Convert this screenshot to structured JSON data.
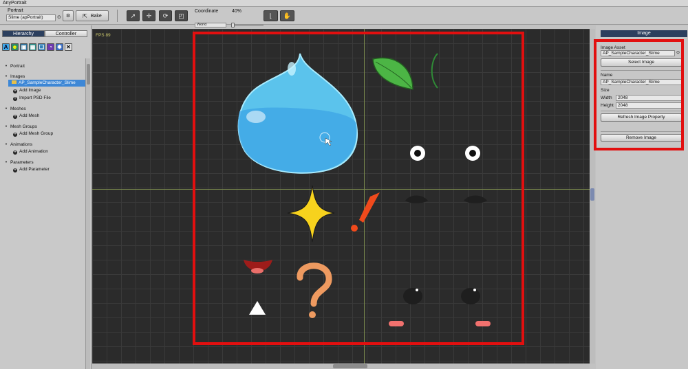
{
  "app": {
    "title": "AnyPortrait"
  },
  "toolbar": {
    "portrait_label": "Portrait",
    "portrait_value": "Slime (apPortrait)",
    "bake_label": "Bake",
    "coordinate_label": "Coordinate",
    "coordinate_value": "World",
    "zoom_label": "40%",
    "zoom_level": 0.0
  },
  "left": {
    "tabs": [
      {
        "label": "Hierarchy"
      },
      {
        "label": "Controller"
      }
    ],
    "tool_icons": [
      "text-icon",
      "face-icon",
      "image-icon",
      "mesh-icon",
      "stack-icon",
      "clock-icon",
      "gear-icon",
      "close-icon"
    ],
    "tree": {
      "portrait": "Portrait",
      "images": "Images",
      "image_item": "AP_SampleCharacter_Slime",
      "add_image": "Add Image",
      "import_psd": "Import PSD File",
      "meshes": "Meshes",
      "add_mesh": "Add Mesh",
      "mesh_groups": "Mesh Groups",
      "add_mesh_group": "Add Mesh Group",
      "animations": "Animations",
      "add_animation": "Add Animation",
      "parameters": "Parameters",
      "add_parameter": "Add Parameter"
    }
  },
  "viewport": {
    "fps": "FPS 89"
  },
  "right": {
    "header": "Image",
    "image_asset_label": "Image Asset",
    "image_asset_value": "AP_SampleCharacter_Slime",
    "select_image": "Select Image",
    "name_label": "Name",
    "name_value": "AP_SampleCharacter_Slime",
    "size_label": "Size",
    "width_label": "Width",
    "width_value": "2048",
    "height_label": "Height",
    "height_value": "2048",
    "refresh_button": "Refresh Image Property",
    "remove_button": "Remove Image"
  },
  "colors": {
    "highlight": "#e20f0f",
    "selection": "#3d87d6",
    "panel_header": "#2c3f5e",
    "canvas": "#2b2b2b"
  }
}
